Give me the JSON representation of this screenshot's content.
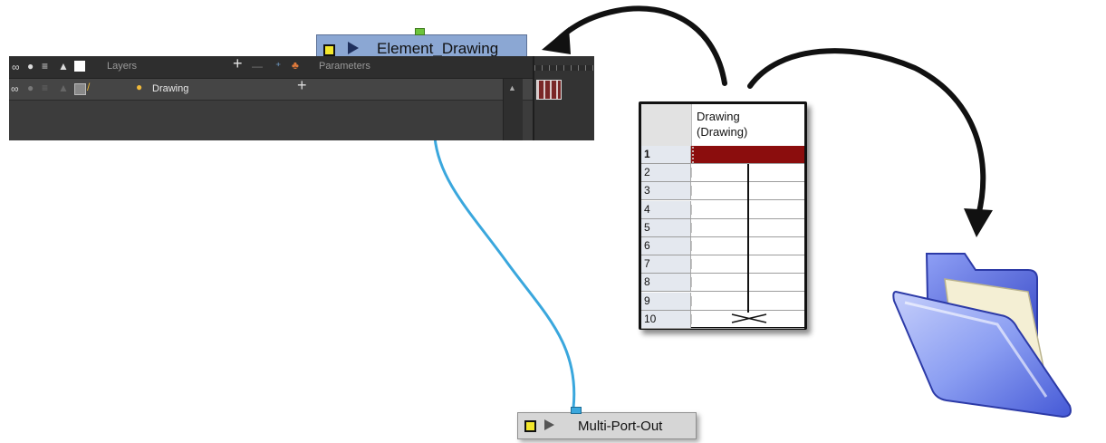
{
  "top_node": {
    "title": "Element_Drawing"
  },
  "timeline": {
    "header_layers": "Layers",
    "header_parameters": "Parameters",
    "layer_name": "Drawing"
  },
  "xsheet": {
    "column_title_line1": "Drawing",
    "column_title_line2": "(Drawing)",
    "rows": [
      "1",
      "2",
      "3",
      "4",
      "5",
      "6",
      "7",
      "8",
      "9",
      "10"
    ],
    "exposure_color": "#8b0d0d"
  },
  "bottom_node": {
    "title": "Multi-Port-Out"
  },
  "colors": {
    "cable": "#3aa7dd",
    "node_blue": "#8ba7d3",
    "panel_dark": "#3c3c3c"
  },
  "icons": [
    "folder-icon",
    "arrow-curve-icon"
  ]
}
